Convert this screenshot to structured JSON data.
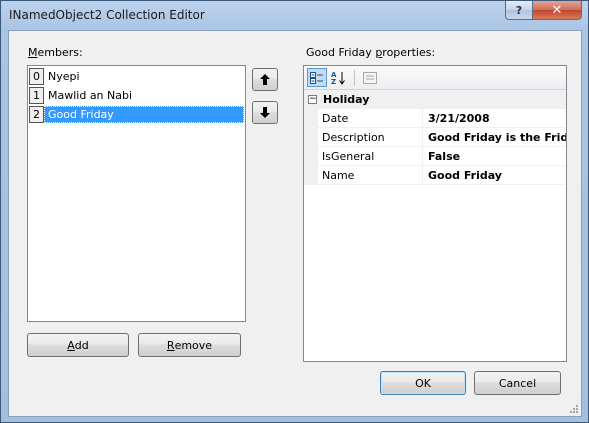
{
  "window": {
    "title": "INamedObject2 Collection Editor",
    "help_label": "?",
    "close_label": "✕"
  },
  "members": {
    "label": "Members:",
    "label_accel": "M",
    "label_rest": "embers:",
    "items": [
      {
        "index": "0",
        "name": "Nyepi"
      },
      {
        "index": "1",
        "name": "Mawlid an Nabi"
      },
      {
        "index": "2",
        "name": "Good Friday",
        "selected": true
      }
    ],
    "up_label": "🡅",
    "down_label": "🡇"
  },
  "buttons": {
    "add_accel": "A",
    "add_rest": "dd",
    "remove_accel": "R",
    "remove_rest": "emove",
    "ok": "OK",
    "cancel": "Cancel"
  },
  "properties": {
    "label_prefix": "Good Friday ",
    "label_accel": "p",
    "label_rest": "roperties:",
    "category": "Holiday",
    "category_toggle": "−",
    "rows": [
      {
        "name": "Date",
        "value": "3/21/2008"
      },
      {
        "name": "Description",
        "value": "Good Friday is the Friday"
      },
      {
        "name": "IsGeneral",
        "value": "False"
      },
      {
        "name": "Name",
        "value": "Good Friday"
      }
    ],
    "toolbar": {
      "categorized_icon": "categorized-icon",
      "alphabetical_icon": "alphabetical-icon",
      "property_pages_icon": "property-pages-icon"
    }
  },
  "colors": {
    "selection": "#3399ff",
    "close_button": "#c2452d"
  }
}
